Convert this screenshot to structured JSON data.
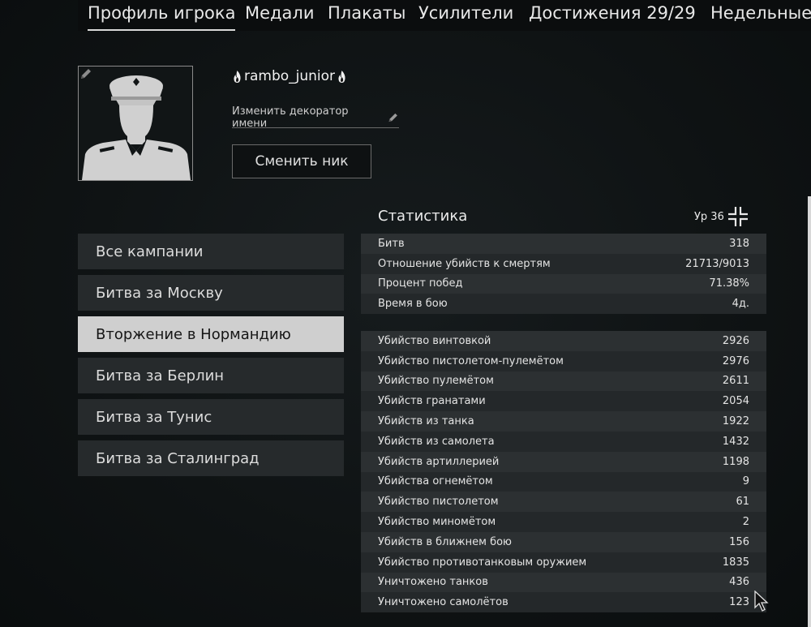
{
  "tabs": [
    {
      "label": "Профиль игрока",
      "active": true
    },
    {
      "label": "Медали"
    },
    {
      "label": "Плакаты"
    },
    {
      "label": "Усилители"
    },
    {
      "label": "Достижения 29/29"
    },
    {
      "label": "Недельные"
    }
  ],
  "profile": {
    "name": "rambo_junior",
    "decorator_label": "Изменить декоратор имени",
    "rename_button": "Сменить ник"
  },
  "campaigns": [
    {
      "label": "Все кампании"
    },
    {
      "label": "Битва за Москву"
    },
    {
      "label": "Вторжение в Нормандию",
      "selected": true
    },
    {
      "label": "Битва за Берлин"
    },
    {
      "label": "Битва за Тунис"
    },
    {
      "label": "Битва за Сталинград"
    }
  ],
  "stats": {
    "title": "Статистика",
    "level_label": "Ур 36",
    "summary": [
      {
        "label": "Битв",
        "value": "318"
      },
      {
        "label": "Отношение убийств к смертям",
        "value": "21713/9013"
      },
      {
        "label": "Процент побед",
        "value": "71.38%"
      },
      {
        "label": "Время в бою",
        "value": "4д."
      }
    ],
    "details": [
      {
        "label": "Убийство винтовкой",
        "value": "2926"
      },
      {
        "label": "Убийство пистолетом-пулемётом",
        "value": "2976"
      },
      {
        "label": "Убийство пулемётом",
        "value": "2611"
      },
      {
        "label": "Убийств гранатами",
        "value": "2054"
      },
      {
        "label": "Убийств из танка",
        "value": "1922"
      },
      {
        "label": "Убийств из самолета",
        "value": "1432"
      },
      {
        "label": "Убийств артиллерией",
        "value": "1198"
      },
      {
        "label": "Убийства огнемётом",
        "value": "9"
      },
      {
        "label": "Убийство пистолетом",
        "value": "61"
      },
      {
        "label": "Убийство миномётом",
        "value": "2"
      },
      {
        "label": "Убийств в ближнем бою",
        "value": "156"
      },
      {
        "label": "Убийство противотанковым оружием",
        "value": "1835"
      },
      {
        "label": "Уничтожено танков",
        "value": "436"
      },
      {
        "label": "Уничтожено самолётов",
        "value": "123"
      }
    ]
  },
  "icons": {
    "avatar": "officer-silhouette-icon",
    "edit": "pencil-icon",
    "name_decor": "flame-icon",
    "rank": "rank-insignia-icon",
    "cursor": "mouse-cursor-icon"
  }
}
